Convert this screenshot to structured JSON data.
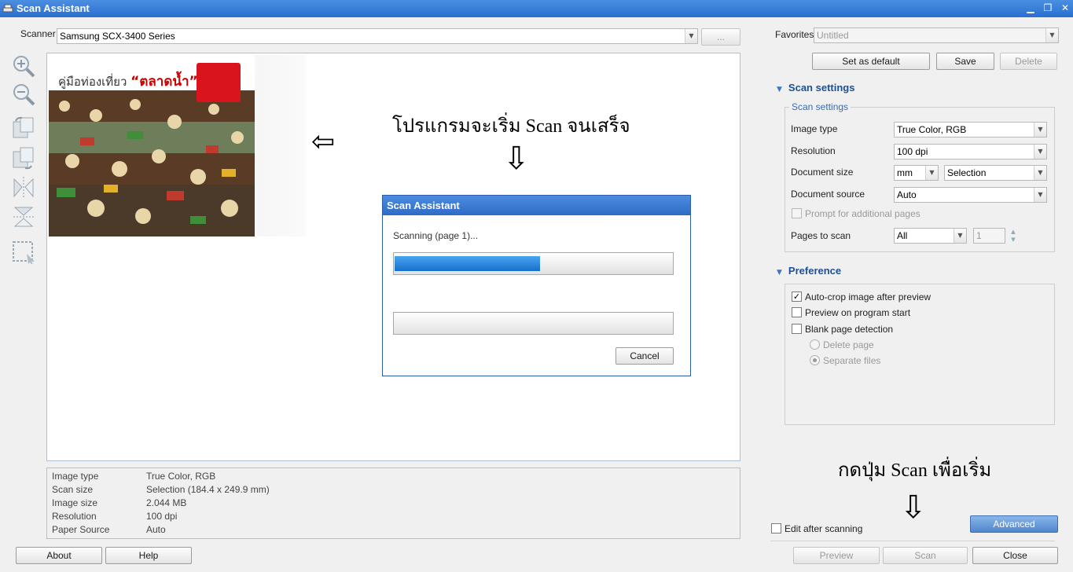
{
  "window": {
    "title": "Scan Assistant",
    "controls": {
      "minimize": "▁",
      "restore": "❐",
      "close": "✕"
    }
  },
  "scanner": {
    "label": "Scanner",
    "value": "Samsung SCX-3400 Series",
    "browse_label": "..."
  },
  "favorites": {
    "label": "Favorites",
    "value": "Untitled",
    "set_default": "Set as default",
    "save": "Save",
    "delete": "Delete"
  },
  "scan_settings": {
    "header": "Scan settings",
    "group_title": "Scan settings",
    "image_type_label": "Image type",
    "image_type": "True Color, RGB",
    "resolution_label": "Resolution",
    "resolution": "100 dpi",
    "document_size_label": "Document size",
    "document_size_unit": "mm",
    "document_size": "Selection",
    "document_source_label": "Document source",
    "document_source": "Auto",
    "prompt_additional": "Prompt for additional pages",
    "pages_to_scan_label": "Pages to scan",
    "pages_to_scan": "All",
    "pages_count": "1"
  },
  "preference": {
    "header": "Preference",
    "auto_crop": "Auto-crop image after preview",
    "preview_on_start": "Preview on program start",
    "blank_page": "Blank page detection",
    "delete_page": "Delete page",
    "separate_files": "Separate files"
  },
  "preview_image": {
    "headline_plain": "คู่มือท่องเที่ยว",
    "headline_emph": "“ตลาดน้ำ”"
  },
  "annotations": {
    "program_scanning": "โปรแกรมจะเริ่ม Scan จนเสร็จ",
    "press_scan": "กดปุ่ม Scan เพื่อเริ่ม",
    "arrow_left": "⇦",
    "arrow_down": "⇩"
  },
  "dialog": {
    "title": "Scan Assistant",
    "status": "Scanning (page 1)...",
    "progress": 0.52,
    "cancel": "Cancel"
  },
  "info": {
    "rows": [
      {
        "key": "Image type",
        "value": "True Color, RGB"
      },
      {
        "key": "Scan size",
        "value": "Selection (184.4 x 249.9 mm)"
      },
      {
        "key": "Image size",
        "value": "2.044 MB"
      },
      {
        "key": "Resolution",
        "value": "100 dpi"
      },
      {
        "key": "Paper Source",
        "value": "Auto"
      }
    ]
  },
  "footer": {
    "about": "About",
    "help": "Help",
    "edit_after": "Edit after scanning",
    "advanced": "Advanced",
    "preview": "Preview",
    "scan": "Scan",
    "close": "Close"
  },
  "colors": {
    "titlebar": "#2a6fd0",
    "accent": "#1c4f99",
    "progress": "#1670cc"
  }
}
